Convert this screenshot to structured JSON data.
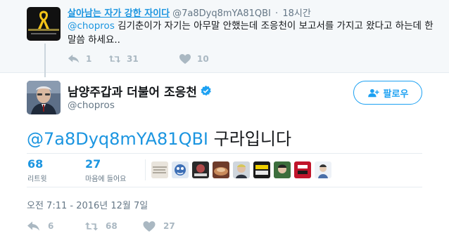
{
  "parent_tweet": {
    "name": "살아남는 자가 강한 자이다",
    "handle": "@7a8Dyq8mYA81QBI",
    "separator": "·",
    "time": "18시간",
    "text_mention": "@chopros",
    "text_body": " 김기춘이가 자기는 아무말 안했는데 조응천이 보고서를 가지고 왔다고 하는데 한 말씀 하세요..",
    "reply_count": "1",
    "retweet_count": "31",
    "like_count": "10"
  },
  "main_tweet": {
    "name": "남양주갑과 더불어 조응천",
    "handle": "@chopros",
    "follow_label": "팔로우",
    "text_mention": "@7a8Dyq8mYA81QBI",
    "text_body": " 구라입니다",
    "stats": {
      "retweets": {
        "value": "68",
        "label": "리트윗"
      },
      "likes": {
        "value": "27",
        "label": "마음에 들어요"
      }
    },
    "timestamp": "오전 7:11 - 2016년 12월 7일",
    "reply_count": "6",
    "retweet_count": "68",
    "like_count": "27"
  },
  "icons": {
    "reply": "reply-icon",
    "retweet": "retweet-icon",
    "like": "heart-icon",
    "verified": "verified-badge-icon",
    "follow": "add-user-icon"
  },
  "colors": {
    "link": "#1b95e0",
    "accent": "#1da1f2",
    "muted": "#657786",
    "action": "#aab8c2",
    "parent_bg": "#f5f8fa"
  }
}
